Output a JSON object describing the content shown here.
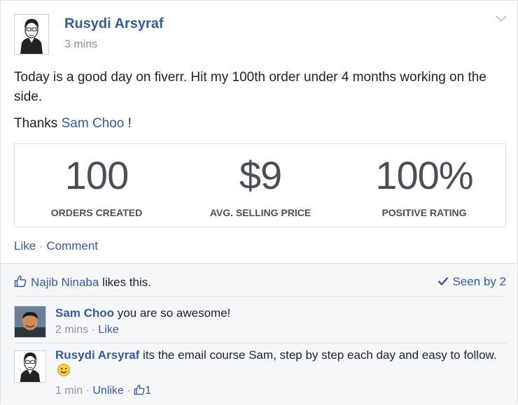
{
  "post": {
    "author": "Rusydi Arsyraf",
    "time": "3 mins",
    "text": "Today is a good day on fiverr. Hit my 100th order under 4 months working on the side.",
    "thanks_prefix": "Thanks ",
    "thanks_link": "Sam Choo",
    "thanks_suffix": " !",
    "stats": [
      {
        "value": "100",
        "label": "ORDERS CREATED"
      },
      {
        "value": "$9",
        "label": "AVG. SELLING PRICE"
      },
      {
        "value": "100%",
        "label": "POSITIVE RATING"
      }
    ],
    "actions": {
      "like": "Like",
      "separator": "·",
      "comment": "Comment"
    }
  },
  "feedback": {
    "liker": "Najib Ninaba",
    "likes_suffix": " likes this.",
    "seen": "Seen by 2"
  },
  "comments": [
    {
      "name": "Sam Choo",
      "text": " you are so awesome!",
      "time": "2 mins",
      "separator": "·",
      "action": "Like"
    },
    {
      "name": "Rusydi Arsyraf",
      "text": " its the email course Sam, step by step each day and easy to follow.",
      "time": "1 min",
      "separator": "·",
      "action": "Unlike",
      "separator2": "·",
      "like_count": "1"
    }
  ],
  "colors": {
    "link": "#3b5998",
    "meta": "#90949c",
    "text": "#1d2129"
  }
}
